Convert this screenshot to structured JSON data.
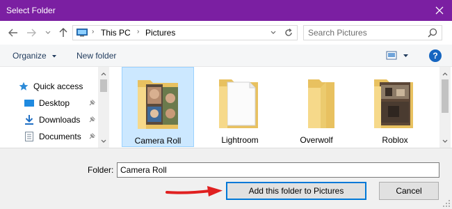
{
  "window": {
    "title": "Select Folder"
  },
  "address": {
    "crumbs": [
      "This PC",
      "Pictures"
    ]
  },
  "search": {
    "placeholder": "Search Pictures"
  },
  "toolbar": {
    "organize_label": "Organize",
    "new_folder_label": "New folder",
    "help_label": "?"
  },
  "nav": {
    "items": [
      {
        "label": "Quick access",
        "icon": "star-icon"
      },
      {
        "label": "Desktop",
        "icon": "desktop-icon",
        "pinned": true
      },
      {
        "label": "Downloads",
        "icon": "download-icon",
        "pinned": true
      },
      {
        "label": "Documents",
        "icon": "document-icon",
        "pinned": true
      }
    ]
  },
  "folders": [
    {
      "name": "Camera Roll",
      "selected": true,
      "preview": "photos"
    },
    {
      "name": "Lightroom",
      "selected": false,
      "preview": "paper"
    },
    {
      "name": "Overwolf",
      "selected": false,
      "preview": "empty"
    },
    {
      "name": "Roblox",
      "selected": false,
      "preview": "screenshot"
    }
  ],
  "footer": {
    "folder_label": "Folder:",
    "folder_value": "Camera Roll",
    "add_button": "Add this folder to Pictures",
    "cancel_button": "Cancel"
  },
  "colors": {
    "titlebar": "#7b1fa2",
    "selection": "#cce8ff",
    "accent": "#0078d7",
    "arrow": "#e02020"
  }
}
